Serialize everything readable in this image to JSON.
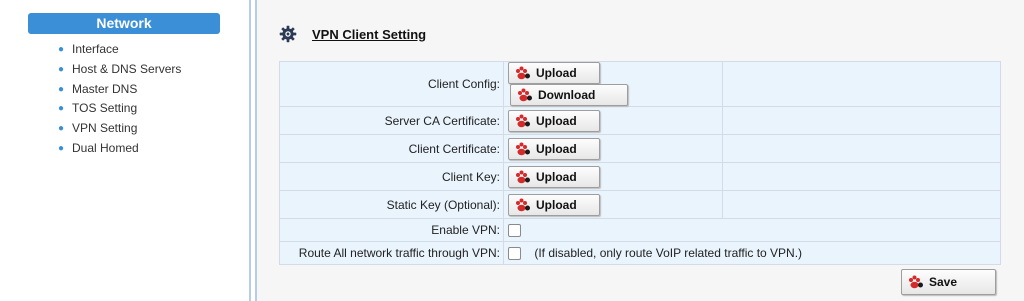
{
  "sidebar": {
    "header": "Network",
    "items": [
      {
        "label": "Interface"
      },
      {
        "label": "Host & DNS Servers"
      },
      {
        "label": "Master DNS"
      },
      {
        "label": "TOS Setting"
      },
      {
        "label": "VPN Setting"
      },
      {
        "label": "Dual Homed"
      }
    ]
  },
  "main": {
    "section_title": "VPN Client Setting",
    "rows": {
      "client_config": {
        "label": "Client Config:",
        "upload": "Upload",
        "download": "Download"
      },
      "server_ca": {
        "label": "Server CA Certificate:",
        "upload": "Upload"
      },
      "client_cert": {
        "label": "Client Certificate:",
        "upload": "Upload"
      },
      "client_key": {
        "label": "Client Key:",
        "upload": "Upload"
      },
      "static_key": {
        "label": "Static Key (Optional):",
        "upload": "Upload"
      },
      "enable_vpn": {
        "label": "Enable VPN:",
        "checked": false
      },
      "route_all": {
        "label": "Route All network traffic through VPN:",
        "checked": false,
        "note": "(If disabled, only route VoIP related traffic to VPN.)"
      }
    },
    "save_label": "Save"
  },
  "icons": {
    "gear": "gear-icon",
    "button": "paw-icon"
  },
  "colors": {
    "accent": "#3a8fd6",
    "table_bg": "#eaf4fd",
    "paw": "#d42a2a"
  }
}
